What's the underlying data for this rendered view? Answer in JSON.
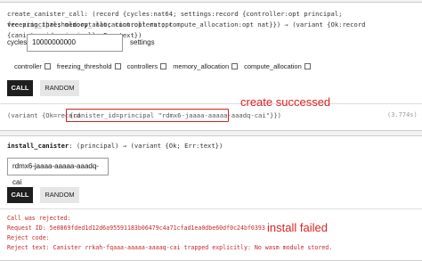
{
  "call1": {
    "signature_line1": "create_canister_call: (record {cycles:nat64; settings:record {controller:opt principal; freezing_threshold:opt nat; controllers:opt",
    "signature_line2": "vec principal; memory_allocation:opt nat; compute_allocation:opt nat}}) → (variant {Ok:record {canister_id:principal}; Err:text})",
    "cycles_label": "cycles",
    "cycles_value": "10000000000",
    "settings_label": "settings",
    "checkboxes": [
      "controller",
      "freezing_threshold",
      "controllers",
      "memory_allocation",
      "compute_allocation"
    ],
    "call_label": "CALL",
    "random_label": "RANDOM",
    "result_prefix": "(variant {Ok=record",
    "result_highlight": "{canister_id=principal \"rdmx6-jaaaa-aaaaa-aaadq-cai\"}})",
    "elapsed": "(3.774s)",
    "annotation": "create  successed"
  },
  "call2": {
    "signature_name": "install_canister",
    "signature_rest": ": (principal) → (variant {Ok; Err:text})",
    "input_value": "rdmx6-jaaaa-aaaaa-aaadq-cai",
    "call_label": "CALL",
    "random_label": "RANDOM",
    "error_lines": [
      "Call was rejected:",
      "Request ID: 5e0869fded1d12d6a95591183b06479c4a71cfad1ea0dbe60df0c24bf0393",
      "Reject code:",
      "Reject text: Canister rrkah-fqaaa-aaaaa-aaaaq-cai trapped explicitly: No wasm module stored."
    ],
    "annotation": "install failed"
  },
  "colors": {
    "annotation": "#e02020",
    "button_dark": "#1e1e1e",
    "error_text": "#c62828"
  }
}
